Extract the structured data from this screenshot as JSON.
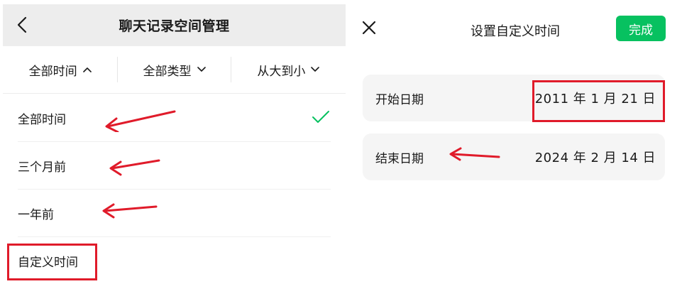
{
  "left": {
    "title": "聊天记录空间管理",
    "filters": {
      "time": "全部时间",
      "type": "全部类型",
      "order": "从大到小"
    },
    "options": [
      {
        "label": "全部时间",
        "selected": true
      },
      {
        "label": "三个月前",
        "selected": false
      },
      {
        "label": "一年前",
        "selected": false
      },
      {
        "label": "自定义时间",
        "selected": false
      }
    ]
  },
  "right": {
    "title": "设置自定义时间",
    "done_label": "完成",
    "start": {
      "label": "开始日期",
      "value": "2011 年 1 月 21 日"
    },
    "end": {
      "label": "结束日期",
      "value": "2024 年 2 月 14 日"
    }
  },
  "colors": {
    "accent_green": "#07c160",
    "annotation_red": "#e01b2a",
    "header_gray": "#ededed",
    "card_gray": "#f5f5f5"
  },
  "icons": [
    "back-chevron-icon",
    "chevron-up-icon",
    "chevron-down-icon",
    "check-icon",
    "close-icon",
    "annotation-arrow-icon"
  ]
}
